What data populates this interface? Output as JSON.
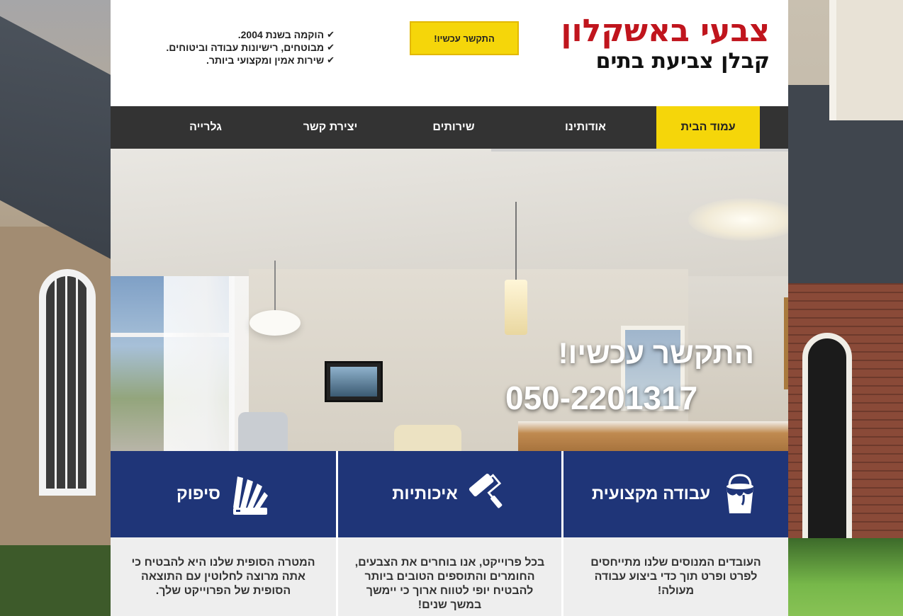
{
  "header": {
    "brand_title": "צבעי באשקלון",
    "brand_subtitle": "קבלן צביעת בתים",
    "cta_button": "התקשר עכשיו!",
    "features": [
      "הוקמה בשנת 2004.",
      "מבוטחים, רישיונות עבודה וביטוחים.",
      "שירות אמין ומקצועי ביותר."
    ]
  },
  "nav": {
    "items": [
      {
        "label": "עמוד הבית",
        "active": true
      },
      {
        "label": "אודותינו",
        "active": false
      },
      {
        "label": "שירותים",
        "active": false
      },
      {
        "label": "יצירת קשר",
        "active": false
      },
      {
        "label": "גלרייה",
        "active": false
      }
    ]
  },
  "hero": {
    "title": "התקשר עכשיו!",
    "phone": "050-2201317"
  },
  "services": [
    {
      "title": "עבודה מקצועית",
      "icon": "paint-bucket-icon",
      "text": "העובדים המנוסים שלנו מתייחסים לפרט ופרט תוך כדי ביצוע עבודה מעולה!"
    },
    {
      "title": "איכותיות",
      "icon": "paint-roller-icon",
      "text": "בכל פרוייקט, אנו בוחרים את הצבעים, החומרים והתוספים הטובים ביותר להבטיח יופי לטווח ארוך כי יימשך במשך שנים!"
    },
    {
      "title": "סיפוק",
      "icon": "color-swatches-icon",
      "text": "המטרה הסופית שלנו היא להבטיח כי אתה מרוצה לחלוטין עם התוצאה הסופית של הפרוייקט שלך."
    }
  ],
  "colors": {
    "brand_red": "#c0151d",
    "accent_yellow": "#f5d60a",
    "nav_dark": "#333333",
    "service_blue": "#1f3578",
    "service_body": "#eeeeee"
  }
}
